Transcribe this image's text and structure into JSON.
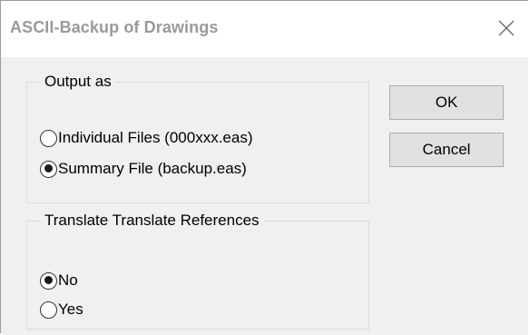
{
  "window": {
    "title": "ASCII-Backup of Drawings"
  },
  "output_group": {
    "legend": "Output as",
    "options": [
      {
        "label": "Individual Files (000xxx.eas)",
        "checked": false
      },
      {
        "label": "Summary File (backup.eas)",
        "checked": true
      }
    ]
  },
  "translate_group": {
    "legend": "Translate Translate References",
    "options": [
      {
        "label": "No",
        "checked": true
      },
      {
        "label": "Yes",
        "checked": false
      }
    ]
  },
  "buttons": {
    "ok_label": "OK",
    "cancel_label": "Cancel"
  },
  "icons": {
    "close": "close-icon",
    "radio": "radio-button-icon"
  },
  "colors": {
    "title_text": "#9a9a9a",
    "dialog_background": "#f0f0f0",
    "button_face": "#e1e1e1",
    "button_border": "#adadad"
  }
}
